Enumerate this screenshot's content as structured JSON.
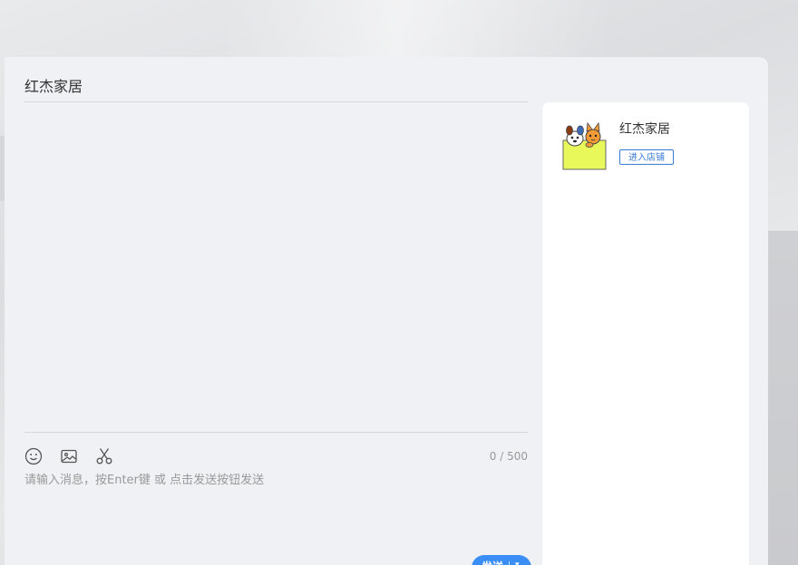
{
  "chat": {
    "shop_title": "红杰家居",
    "char_count": "0 / 500",
    "input_placeholder": "请输入消息，按Enter键 或 点击发送按钮发送",
    "send_label": "发送",
    "toolbar": [
      "emoji-icon",
      "image-icon",
      "scissors-icon"
    ]
  },
  "shop_card": {
    "name": "红杰家居",
    "enter_shop_label": "进入店铺"
  },
  "colors": {
    "accent": "#3a8ef5",
    "link": "#3a7bd5",
    "panel_bg": "#f0f1f5"
  }
}
